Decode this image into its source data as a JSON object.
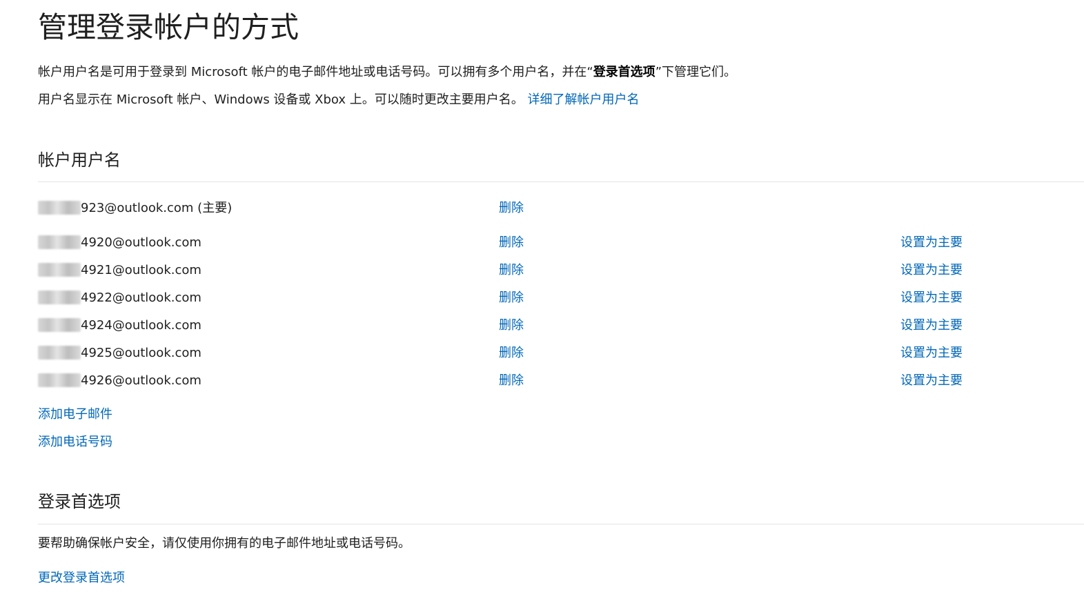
{
  "page": {
    "title": "管理登录帐户的方式",
    "intro1_before": "帐户用户名是可用于登录到 Microsoft 帐户的电子邮件地址或电话号码。可以拥有多个用户名，并在“",
    "intro1_bold": "登录首选项",
    "intro1_after": "”下管理它们。",
    "intro2_text": "用户名显示在 Microsoft 帐户、Windows 设备或 Xbox 上。可以随时更改主要用户名。",
    "intro2_link": "详细了解帐户用户名"
  },
  "aliases_section": {
    "title": "帐户用户名",
    "rows": [
      {
        "name": "923@outlook.com (主要)",
        "remove": "删除",
        "set_primary": ""
      },
      {
        "name": "4920@outlook.com",
        "remove": "删除",
        "set_primary": "设置为主要"
      },
      {
        "name": "4921@outlook.com",
        "remove": "删除",
        "set_primary": "设置为主要"
      },
      {
        "name": "4922@outlook.com",
        "remove": "删除",
        "set_primary": "设置为主要"
      },
      {
        "name": "4924@outlook.com",
        "remove": "删除",
        "set_primary": "设置为主要"
      },
      {
        "name": "4925@outlook.com",
        "remove": "删除",
        "set_primary": "设置为主要"
      },
      {
        "name": "4926@outlook.com",
        "remove": "删除",
        "set_primary": "设置为主要"
      }
    ],
    "add_email": "添加电子邮件",
    "add_phone": "添加电话号码"
  },
  "preferences_section": {
    "title": "登录首选项",
    "description": "要帮助确保帐户安全，请仅使用你拥有的电子邮件地址或电话号码。",
    "change_link": "更改登录首选项"
  },
  "colors": {
    "link": "#0067b8",
    "text": "#1f1f1f",
    "divider": "#e3e3e3"
  }
}
